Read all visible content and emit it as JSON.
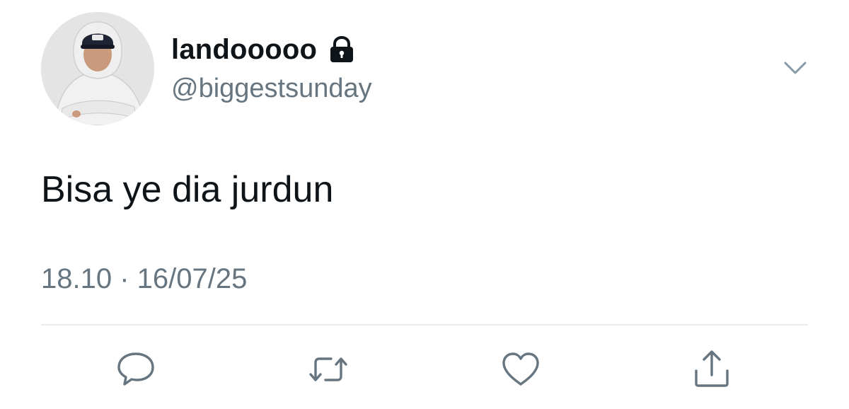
{
  "user": {
    "display_name": "landooooo",
    "handle": "@biggestsunday",
    "protected_icon": "lock-icon",
    "avatar": "profile-photo"
  },
  "tweet": {
    "text": "Bisa ye dia jurdun",
    "timestamp": "18.10 · 16/07/25"
  },
  "menu": {
    "icon": "chevron-down-icon"
  },
  "actions": [
    {
      "name": "reply",
      "icon": "speech-bubble-icon"
    },
    {
      "name": "retweet",
      "icon": "retweet-arrows-icon"
    },
    {
      "name": "like",
      "icon": "heart-icon"
    },
    {
      "name": "share",
      "icon": "share-upload-icon"
    }
  ],
  "colors": {
    "text_primary": "#0f1419",
    "text_secondary": "#66757f",
    "icon_gray": "#66757f",
    "divider": "#e6ecf0"
  }
}
